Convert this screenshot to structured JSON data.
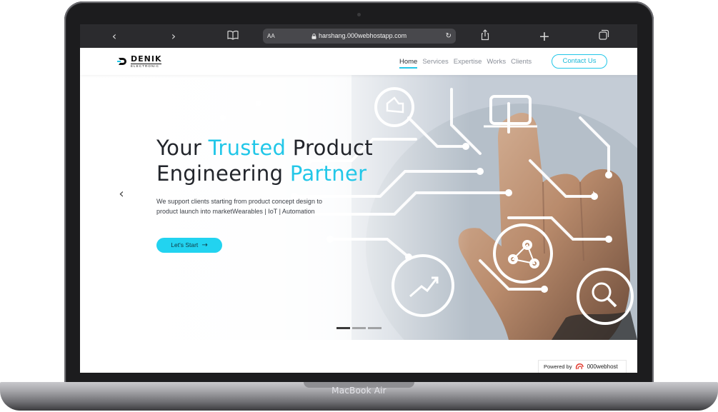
{
  "device": {
    "model_label": "MacBook Air"
  },
  "browser": {
    "text_size_label": "AA",
    "url": "harshang.000webhostapp.com",
    "icons": [
      "chevron-left-icon",
      "chevron-right-icon",
      "book-icon",
      "lock-icon",
      "reload-icon",
      "share-icon",
      "plus-icon",
      "tabs-icon"
    ]
  },
  "site": {
    "logo": {
      "name": "DENIK",
      "sub": "ELECTRONIC"
    },
    "nav": [
      {
        "label": "Home",
        "active": true
      },
      {
        "label": "Services",
        "active": false
      },
      {
        "label": "Expertise",
        "active": false
      },
      {
        "label": "Works",
        "active": false
      },
      {
        "label": "Clients",
        "active": false
      }
    ],
    "contact_label": "Contact Us",
    "accent_color": "#22c7e8"
  },
  "hero": {
    "title_line1_pre": "Your ",
    "title_line1_accent": "Trusted",
    "title_line1_post": " Product",
    "title_line2_pre": "Engineering ",
    "title_line2_accent": "Partner",
    "description": "We support clients starting from product concept design to product launch into marketWearables | IoT | Automation",
    "cta_label": "Let's Start",
    "slides_count": 3,
    "active_slide": 1
  },
  "footer": {
    "powered_by": "Powered by",
    "host_name": "000webhost"
  }
}
